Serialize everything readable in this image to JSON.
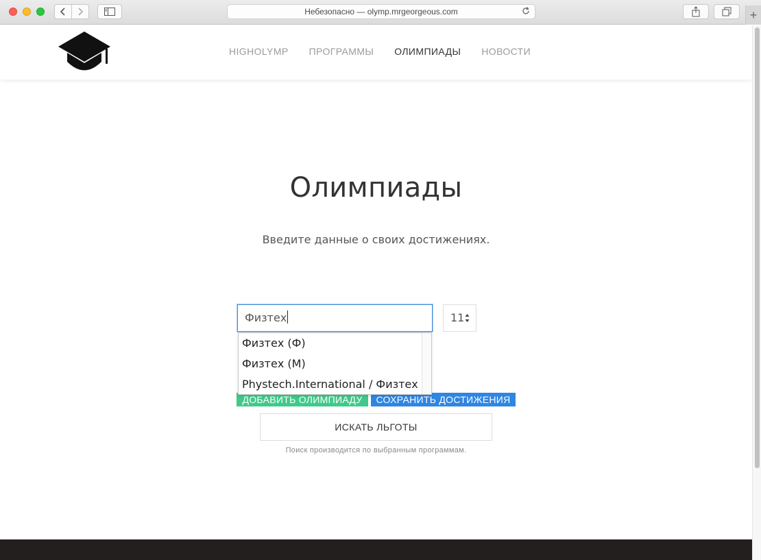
{
  "browser": {
    "address": "Небезопасно — olymp.mrgeorgeous.com",
    "new_tab_glyph": "+"
  },
  "header": {
    "logo_icon": "graduation-cap-icon",
    "nav": [
      {
        "label": "HIGHOLYMP",
        "active": false
      },
      {
        "label": "ПРОГРАММЫ",
        "active": false
      },
      {
        "label": "ОЛИМПИАДЫ",
        "active": true
      },
      {
        "label": "НОВОСТИ",
        "active": false
      }
    ]
  },
  "main": {
    "title": "Олимпиады",
    "subtitle": "Введите данные о своих достижениях.",
    "olympiad_input_value": "Физтех",
    "grade_value": "11",
    "suggestions": [
      "Физтех (Ф)",
      "Физтех (М)",
      "Phystech.International / Физтех"
    ],
    "add_button": "ДОБАВИТЬ ОЛИМПИАДУ",
    "save_button": "СОХРАНИТЬ ДОСТИЖЕНИЯ",
    "search_button": "ИСКАТЬ ЛЬГОТЫ",
    "hint": "Поиск производится по выбранным программам."
  },
  "colors": {
    "add_button": "#3fca89",
    "save_button": "#2f86e2",
    "footer": "#231f1e",
    "input_focus": "#4a90d9"
  }
}
